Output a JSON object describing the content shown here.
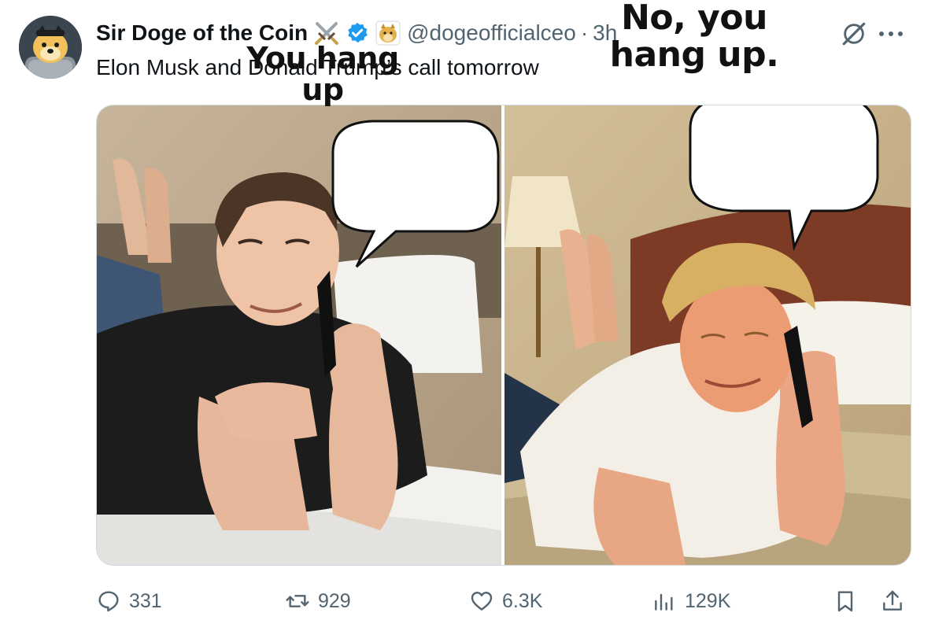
{
  "author": {
    "name": "Sir Doge of the Coin",
    "handle": "@dogeofficialceo",
    "separator": "·",
    "time": "3h"
  },
  "tweet": {
    "text": "Elon Musk and Donald Trump’s call tomorrow"
  },
  "media": {
    "left_bubble": "You hang up",
    "right_bubble": "No, you hang up."
  },
  "actions": {
    "replies": "331",
    "reposts": "929",
    "likes": "6.3K",
    "views": "129K"
  },
  "icons": {
    "swords": "crossed-swords-icon",
    "verified": "verified-badge-icon",
    "affiliate": "doge-affiliate-icon",
    "grok": "grok-icon",
    "more": "more-icon",
    "reply": "reply-icon",
    "repost": "repost-icon",
    "like": "heart-icon",
    "views": "views-icon",
    "bookmark": "bookmark-icon",
    "share": "share-icon"
  },
  "colors": {
    "verified": "#1d9bf0",
    "text_primary": "#0f1419",
    "text_secondary": "#536471"
  }
}
